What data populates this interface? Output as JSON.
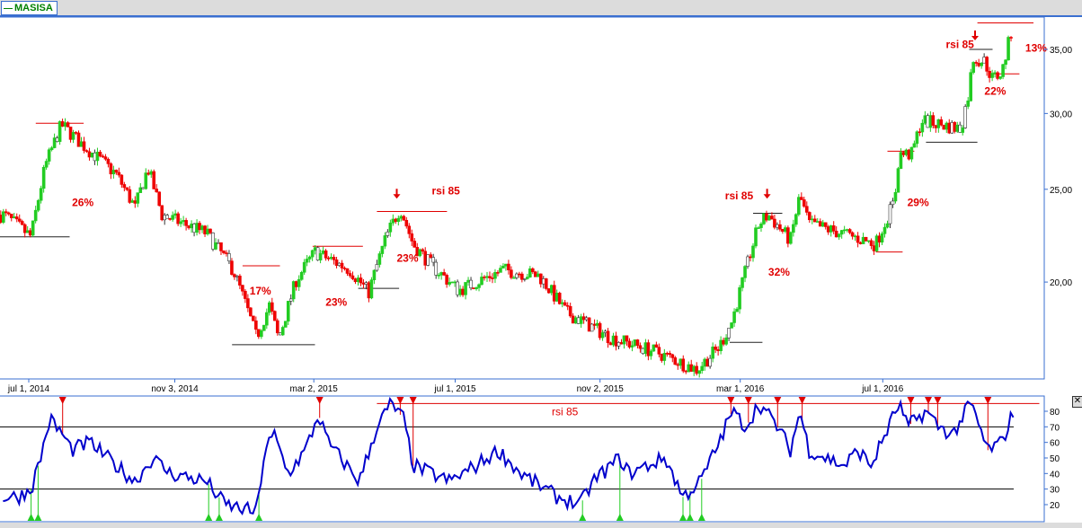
{
  "legend": {
    "symbol": "MASISA",
    "color": "#008000"
  },
  "colors": {
    "up": "#22cc22",
    "down": "#ee0000",
    "rsi": "#0000cc",
    "border": "#3a6fd0",
    "signal_line": "#dd0000"
  },
  "chart_data": [
    {
      "type": "candlestick",
      "title": "MASISA",
      "x_unit": "days since 2014-07-01",
      "x_tick_labels": [
        {
          "day": 0,
          "label": "jul 1, 2014"
        },
        {
          "day": 125,
          "label": "nov 3, 2014"
        },
        {
          "day": 244,
          "label": "mar 2, 2015"
        },
        {
          "day": 365,
          "label": "jul 1, 2015"
        },
        {
          "day": 489,
          "label": "nov 2, 2015"
        },
        {
          "day": 609,
          "label": "mar 1, 2016"
        },
        {
          "day": 731,
          "label": "jul 1, 2016"
        }
      ],
      "y_scale": "log",
      "y_ticks": [
        {
          "v": 20,
          "label": "20,00"
        },
        {
          "v": 25,
          "label": "25,00"
        },
        {
          "v": 30,
          "label": "30,00"
        },
        {
          "v": 35,
          "label": "35,00"
        }
      ],
      "approx_close": [
        [
          -21,
          23.5
        ],
        [
          2,
          22.3
        ],
        [
          14,
          26.4
        ],
        [
          28,
          29.2
        ],
        [
          45,
          27.9
        ],
        [
          75,
          25.9
        ],
        [
          91,
          23.9
        ],
        [
          102,
          26.3
        ],
        [
          114,
          23.5
        ],
        [
          152,
          22.5
        ],
        [
          175,
          20.6
        ],
        [
          195,
          17.5
        ],
        [
          206,
          18.9
        ],
        [
          214,
          17.4
        ],
        [
          229,
          20.1
        ],
        [
          245,
          21.5
        ],
        [
          275,
          20.6
        ],
        [
          291,
          19.5
        ],
        [
          306,
          22.3
        ],
        [
          318,
          23.9
        ],
        [
          329,
          21.9
        ],
        [
          345,
          20.8
        ],
        [
          368,
          19.6
        ],
        [
          406,
          20.6
        ],
        [
          437,
          20.3
        ],
        [
          460,
          18.6
        ],
        [
          498,
          17.5
        ],
        [
          537,
          16.9
        ],
        [
          572,
          16.2
        ],
        [
          591,
          17.1
        ],
        [
          602,
          18.2
        ],
        [
          614,
          20.6
        ],
        [
          625,
          23.0
        ],
        [
          633,
          23.5
        ],
        [
          652,
          22.1
        ],
        [
          660,
          24.6
        ],
        [
          668,
          23.0
        ],
        [
          706,
          22.3
        ],
        [
          725,
          21.9
        ],
        [
          741,
          24.3
        ],
        [
          745,
          27.2
        ],
        [
          756,
          27.2
        ],
        [
          764,
          29.5
        ],
        [
          798,
          28.9
        ],
        [
          805,
          31.7
        ],
        [
          808,
          34.3
        ],
        [
          818,
          34.0
        ],
        [
          825,
          32.6
        ],
        [
          833,
          33.1
        ],
        [
          841,
          36.5
        ]
      ],
      "levels": [
        {
          "from": 6,
          "to": 47,
          "price": 29.3,
          "color": "red"
        },
        {
          "from": -25,
          "to": 35,
          "price": 22.3,
          "color": "black"
        },
        {
          "from": 183,
          "to": 215,
          "price": 20.8,
          "color": "red"
        },
        {
          "from": 174,
          "to": 245,
          "price": 17.2,
          "color": "black"
        },
        {
          "from": 243,
          "to": 286,
          "price": 21.8,
          "color": "red"
        },
        {
          "from": 282,
          "to": 317,
          "price": 19.7,
          "color": "black"
        },
        {
          "from": 298,
          "to": 358,
          "price": 23.7,
          "color": "red"
        },
        {
          "from": 600,
          "to": 628,
          "price": 17.3,
          "color": "black"
        },
        {
          "from": 620,
          "to": 645,
          "price": 23.6,
          "color": "black"
        },
        {
          "from": 725,
          "to": 748,
          "price": 21.5,
          "color": "red"
        },
        {
          "from": 735,
          "to": 758,
          "price": 27.4,
          "color": "red"
        },
        {
          "from": 768,
          "to": 812,
          "price": 28.0,
          "color": "black"
        },
        {
          "from": 805,
          "to": 825,
          "price": 35.0,
          "color": "black"
        },
        {
          "from": 825,
          "to": 848,
          "price": 33.0,
          "color": "red"
        },
        {
          "from": 812,
          "to": 860,
          "price": 37.3,
          "color": "red"
        }
      ],
      "annotations": [
        {
          "day": 37,
          "price": 24.0,
          "text": "26%"
        },
        {
          "day": 189,
          "price": 19.4,
          "text": "17%"
        },
        {
          "day": 254,
          "price": 18.9,
          "text": "23%"
        },
        {
          "day": 315,
          "price": 21.0,
          "text": "23%"
        },
        {
          "day": 345,
          "price": 24.7,
          "text": "rsi 85"
        },
        {
          "day": 633,
          "price": 20.3,
          "text": "32%"
        },
        {
          "day": 596,
          "price": 24.4,
          "text": "rsi 85"
        },
        {
          "day": 752,
          "price": 24.0,
          "text": "29%"
        },
        {
          "day": 818,
          "price": 31.4,
          "text": "22%"
        },
        {
          "day": 785,
          "price": 35.1,
          "text": "rsi 85"
        },
        {
          "day": 853,
          "price": 34.8,
          "text": "13%"
        }
      ],
      "arrows": [
        {
          "day": 315,
          "price": 24.6
        },
        {
          "day": 632,
          "price": 24.6
        },
        {
          "day": 810,
          "price": 36.0
        }
      ]
    },
    {
      "type": "line",
      "title": "RSI",
      "ylim": [
        10,
        90
      ],
      "y_ticks": [
        20,
        30,
        40,
        50,
        60,
        70,
        80
      ],
      "hlines": [
        30,
        70
      ],
      "signal_level": {
        "value": 85,
        "from": 298,
        "to": 865,
        "label": "rsi 85"
      },
      "values": [
        [
          -9,
          25
        ],
        [
          2,
          30
        ],
        [
          10,
          50
        ],
        [
          18,
          75
        ],
        [
          29,
          65
        ],
        [
          37,
          55
        ],
        [
          52,
          60
        ],
        [
          75,
          45
        ],
        [
          91,
          35
        ],
        [
          106,
          50
        ],
        [
          121,
          40
        ],
        [
          152,
          35
        ],
        [
          168,
          20
        ],
        [
          195,
          15
        ],
        [
          202,
          55
        ],
        [
          210,
          65
        ],
        [
          222,
          40
        ],
        [
          237,
          55
        ],
        [
          248,
          78
        ],
        [
          256,
          60
        ],
        [
          283,
          35
        ],
        [
          298,
          70
        ],
        [
          310,
          85
        ],
        [
          321,
          75
        ],
        [
          329,
          45
        ],
        [
          360,
          35
        ],
        [
          383,
          45
        ],
        [
          402,
          55
        ],
        [
          421,
          40
        ],
        [
          452,
          25
        ],
        [
          472,
          20
        ],
        [
          483,
          35
        ],
        [
          506,
          50
        ],
        [
          514,
          40
        ],
        [
          545,
          50
        ],
        [
          560,
          25
        ],
        [
          575,
          35
        ],
        [
          591,
          60
        ],
        [
          602,
          80
        ],
        [
          614,
          70
        ],
        [
          625,
          85
        ],
        [
          641,
          70
        ],
        [
          652,
          55
        ],
        [
          660,
          80
        ],
        [
          668,
          55
        ],
        [
          698,
          45
        ],
        [
          710,
          55
        ],
        [
          721,
          45
        ],
        [
          733,
          65
        ],
        [
          745,
          85
        ],
        [
          752,
          70
        ],
        [
          768,
          80
        ],
        [
          779,
          70
        ],
        [
          791,
          65
        ],
        [
          806,
          85
        ],
        [
          821,
          55
        ],
        [
          833,
          60
        ],
        [
          843,
          80
        ]
      ],
      "sell_signals": [
        29,
        249,
        318,
        329,
        601,
        616,
        641,
        662,
        755,
        770,
        778,
        821
      ],
      "buy_signals": [
        2,
        8,
        154,
        163,
        197,
        474,
        506,
        560,
        566,
        576
      ]
    }
  ]
}
